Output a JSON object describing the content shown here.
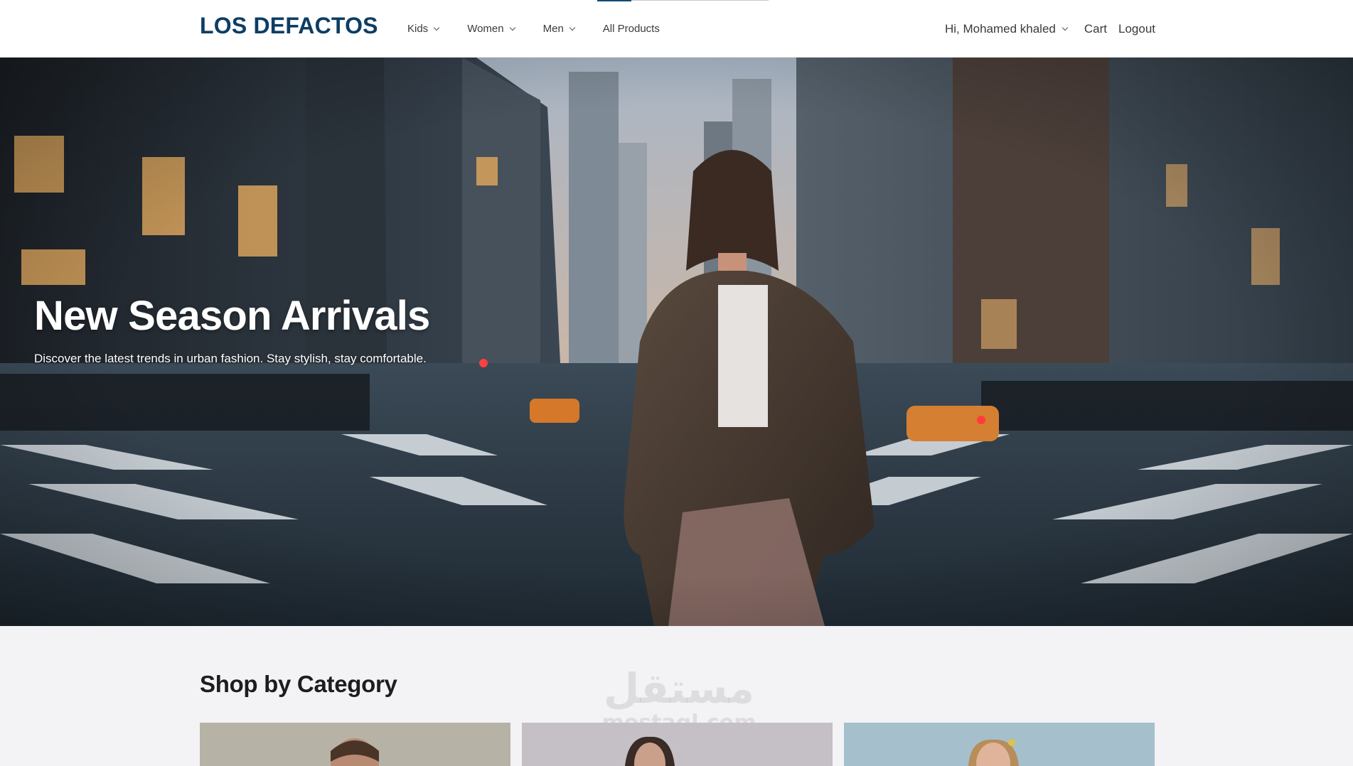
{
  "header": {
    "logo": "LOS DEFACTOS",
    "nav": [
      {
        "label": "Kids",
        "has_dropdown": true
      },
      {
        "label": "Women",
        "has_dropdown": true
      },
      {
        "label": "Men",
        "has_dropdown": true
      },
      {
        "label": "All Products",
        "has_dropdown": false
      }
    ],
    "user_greeting": "Hi, Mohamed khaled",
    "cart_label": "Cart",
    "logout_label": "Logout"
  },
  "hero": {
    "title": "New Season Arrivals",
    "subtitle": "Discover the latest trends in urban fashion. Stay stylish, stay comfortable."
  },
  "categories": {
    "title": "Shop by Category",
    "cards": [
      {
        "name": "men-category"
      },
      {
        "name": "women-category"
      },
      {
        "name": "kids-category"
      }
    ]
  },
  "watermark": {
    "arabic": "مستقل",
    "latin": "mostaql.com"
  },
  "colors": {
    "brand": "#0d3d63",
    "page_bg": "#f3f3f5",
    "header_bg": "#ffffff"
  }
}
